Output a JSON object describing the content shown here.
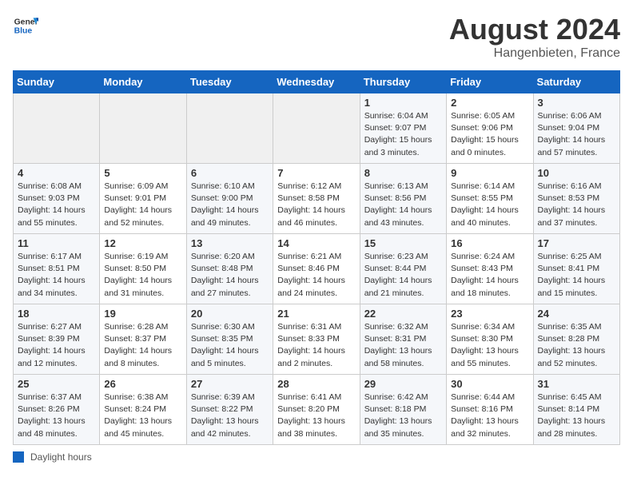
{
  "header": {
    "logo_general": "General",
    "logo_blue": "Blue",
    "month_year": "August 2024",
    "location": "Hangenbieten, France"
  },
  "days_of_week": [
    "Sunday",
    "Monday",
    "Tuesday",
    "Wednesday",
    "Thursday",
    "Friday",
    "Saturday"
  ],
  "weeks": [
    [
      {
        "num": "",
        "detail": ""
      },
      {
        "num": "",
        "detail": ""
      },
      {
        "num": "",
        "detail": ""
      },
      {
        "num": "",
        "detail": ""
      },
      {
        "num": "1",
        "detail": "Sunrise: 6:04 AM\nSunset: 9:07 PM\nDaylight: 15 hours\nand 3 minutes."
      },
      {
        "num": "2",
        "detail": "Sunrise: 6:05 AM\nSunset: 9:06 PM\nDaylight: 15 hours\nand 0 minutes."
      },
      {
        "num": "3",
        "detail": "Sunrise: 6:06 AM\nSunset: 9:04 PM\nDaylight: 14 hours\nand 57 minutes."
      }
    ],
    [
      {
        "num": "4",
        "detail": "Sunrise: 6:08 AM\nSunset: 9:03 PM\nDaylight: 14 hours\nand 55 minutes."
      },
      {
        "num": "5",
        "detail": "Sunrise: 6:09 AM\nSunset: 9:01 PM\nDaylight: 14 hours\nand 52 minutes."
      },
      {
        "num": "6",
        "detail": "Sunrise: 6:10 AM\nSunset: 9:00 PM\nDaylight: 14 hours\nand 49 minutes."
      },
      {
        "num": "7",
        "detail": "Sunrise: 6:12 AM\nSunset: 8:58 PM\nDaylight: 14 hours\nand 46 minutes."
      },
      {
        "num": "8",
        "detail": "Sunrise: 6:13 AM\nSunset: 8:56 PM\nDaylight: 14 hours\nand 43 minutes."
      },
      {
        "num": "9",
        "detail": "Sunrise: 6:14 AM\nSunset: 8:55 PM\nDaylight: 14 hours\nand 40 minutes."
      },
      {
        "num": "10",
        "detail": "Sunrise: 6:16 AM\nSunset: 8:53 PM\nDaylight: 14 hours\nand 37 minutes."
      }
    ],
    [
      {
        "num": "11",
        "detail": "Sunrise: 6:17 AM\nSunset: 8:51 PM\nDaylight: 14 hours\nand 34 minutes."
      },
      {
        "num": "12",
        "detail": "Sunrise: 6:19 AM\nSunset: 8:50 PM\nDaylight: 14 hours\nand 31 minutes."
      },
      {
        "num": "13",
        "detail": "Sunrise: 6:20 AM\nSunset: 8:48 PM\nDaylight: 14 hours\nand 27 minutes."
      },
      {
        "num": "14",
        "detail": "Sunrise: 6:21 AM\nSunset: 8:46 PM\nDaylight: 14 hours\nand 24 minutes."
      },
      {
        "num": "15",
        "detail": "Sunrise: 6:23 AM\nSunset: 8:44 PM\nDaylight: 14 hours\nand 21 minutes."
      },
      {
        "num": "16",
        "detail": "Sunrise: 6:24 AM\nSunset: 8:43 PM\nDaylight: 14 hours\nand 18 minutes."
      },
      {
        "num": "17",
        "detail": "Sunrise: 6:25 AM\nSunset: 8:41 PM\nDaylight: 14 hours\nand 15 minutes."
      }
    ],
    [
      {
        "num": "18",
        "detail": "Sunrise: 6:27 AM\nSunset: 8:39 PM\nDaylight: 14 hours\nand 12 minutes."
      },
      {
        "num": "19",
        "detail": "Sunrise: 6:28 AM\nSunset: 8:37 PM\nDaylight: 14 hours\nand 8 minutes."
      },
      {
        "num": "20",
        "detail": "Sunrise: 6:30 AM\nSunset: 8:35 PM\nDaylight: 14 hours\nand 5 minutes."
      },
      {
        "num": "21",
        "detail": "Sunrise: 6:31 AM\nSunset: 8:33 PM\nDaylight: 14 hours\nand 2 minutes."
      },
      {
        "num": "22",
        "detail": "Sunrise: 6:32 AM\nSunset: 8:31 PM\nDaylight: 13 hours\nand 58 minutes."
      },
      {
        "num": "23",
        "detail": "Sunrise: 6:34 AM\nSunset: 8:30 PM\nDaylight: 13 hours\nand 55 minutes."
      },
      {
        "num": "24",
        "detail": "Sunrise: 6:35 AM\nSunset: 8:28 PM\nDaylight: 13 hours\nand 52 minutes."
      }
    ],
    [
      {
        "num": "25",
        "detail": "Sunrise: 6:37 AM\nSunset: 8:26 PM\nDaylight: 13 hours\nand 48 minutes."
      },
      {
        "num": "26",
        "detail": "Sunrise: 6:38 AM\nSunset: 8:24 PM\nDaylight: 13 hours\nand 45 minutes."
      },
      {
        "num": "27",
        "detail": "Sunrise: 6:39 AM\nSunset: 8:22 PM\nDaylight: 13 hours\nand 42 minutes."
      },
      {
        "num": "28",
        "detail": "Sunrise: 6:41 AM\nSunset: 8:20 PM\nDaylight: 13 hours\nand 38 minutes."
      },
      {
        "num": "29",
        "detail": "Sunrise: 6:42 AM\nSunset: 8:18 PM\nDaylight: 13 hours\nand 35 minutes."
      },
      {
        "num": "30",
        "detail": "Sunrise: 6:44 AM\nSunset: 8:16 PM\nDaylight: 13 hours\nand 32 minutes."
      },
      {
        "num": "31",
        "detail": "Sunrise: 6:45 AM\nSunset: 8:14 PM\nDaylight: 13 hours\nand 28 minutes."
      }
    ]
  ],
  "footer": {
    "daylight_label": "Daylight hours"
  }
}
